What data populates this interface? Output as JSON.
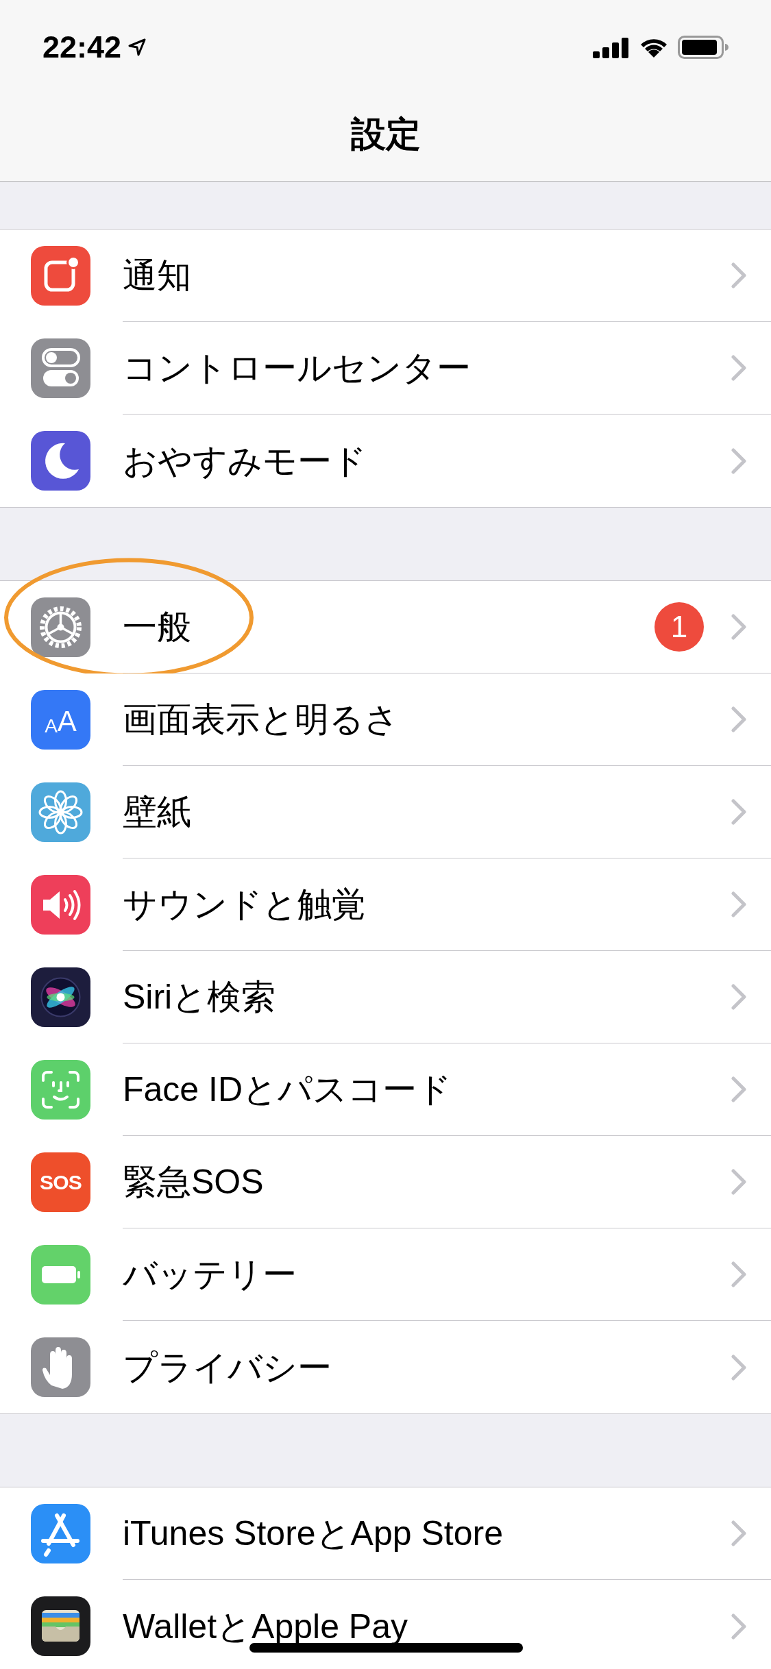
{
  "status_bar": {
    "time": "22:42"
  },
  "nav": {
    "title": "設定"
  },
  "groups": [
    {
      "rows": [
        {
          "label": "通知",
          "kind": "notifications",
          "color": "#ee4b3d",
          "circled": false
        },
        {
          "label": "コントロールセンター",
          "kind": "control",
          "color": "#8e8e93",
          "circled": false
        },
        {
          "label": "おやすみモード",
          "kind": "moon",
          "color": "#5856d6",
          "circled": false
        }
      ]
    },
    {
      "rows": [
        {
          "label": "一般",
          "kind": "gear",
          "color": "#8e8e93",
          "badge": "1",
          "circled": true
        },
        {
          "label": "画面表示と明るさ",
          "kind": "text",
          "icon_text": "AA",
          "color": "#3478f6",
          "circled": false
        },
        {
          "label": "壁紙",
          "kind": "flower",
          "color": "#4fa9db",
          "circled": false
        },
        {
          "label": "サウンドと触覚",
          "kind": "speaker",
          "color": "#ee3f5a",
          "circled": false
        },
        {
          "label": "Siriと検索",
          "kind": "siri",
          "color": "#1d1d3d",
          "circled": false
        },
        {
          "label": "Face IDとパスコード",
          "kind": "face",
          "color": "#5dd06b",
          "circled": false
        },
        {
          "label": "緊急SOS",
          "kind": "text",
          "icon_text": "SOS",
          "color": "#ee4f2b",
          "circled": false
        },
        {
          "label": "バッテリー",
          "kind": "battery",
          "color": "#63d26a",
          "circled": false
        },
        {
          "label": "プライバシー",
          "kind": "hand",
          "color": "#8e8e93",
          "circled": false
        }
      ]
    },
    {
      "rows": [
        {
          "label": "iTunes StoreとApp Store",
          "kind": "appstore",
          "color": "#2b8ff6",
          "circled": false
        },
        {
          "label": "WalletとApple Pay",
          "kind": "wallet",
          "color": "#1c1c1e",
          "circled": false
        }
      ]
    }
  ]
}
